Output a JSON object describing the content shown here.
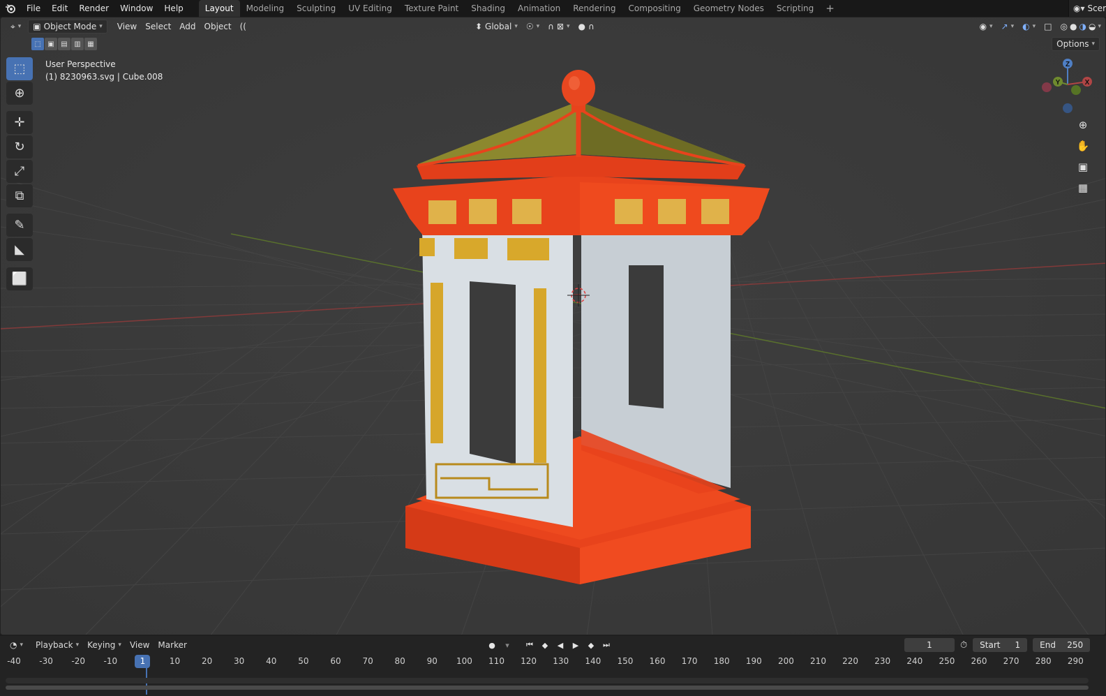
{
  "topbar": {
    "logo_icon": "blender-logo-icon",
    "menus": [
      "File",
      "Edit",
      "Render",
      "Window",
      "Help"
    ],
    "workspaces": [
      "Layout",
      "Modeling",
      "Sculpting",
      "UV Editing",
      "Texture Paint",
      "Shading",
      "Animation",
      "Rendering",
      "Compositing",
      "Geometry Nodes",
      "Scripting"
    ],
    "active_workspace": "Layout",
    "add_workspace": "+",
    "scene_label": "Scer"
  },
  "viewport_header": {
    "editor_type_icon": "3d-viewport-icon",
    "mode": "Object Mode",
    "menus": [
      "View",
      "Select",
      "Add",
      "Object"
    ],
    "transform_orientation": "Global",
    "options_label": "Options"
  },
  "viewport": {
    "perspective_label": "User Perspective",
    "object_label": "(1) 8230963.svg | Cube.008",
    "gizmo_axes": {
      "x": "X",
      "y": "Y",
      "z": "Z"
    },
    "colors": {
      "background": "#3a3a3a",
      "x_axis": "#b04545",
      "y_axis": "#6f8a2e",
      "z_axis": "#4f7fc4",
      "accent": "#4772b3",
      "model_red": "#e8431c",
      "model_gold": "#d8a82b",
      "model_white": "#d7dde2"
    }
  },
  "toolbar": {
    "tools": [
      {
        "name": "select-box",
        "icon": "select-box-icon",
        "active": true
      },
      {
        "name": "cursor",
        "icon": "cursor-icon",
        "active": false
      },
      {
        "name": "move",
        "icon": "move-icon",
        "active": false
      },
      {
        "name": "rotate",
        "icon": "rotate-icon",
        "active": false
      },
      {
        "name": "scale",
        "icon": "scale-icon",
        "active": false
      },
      {
        "name": "transform",
        "icon": "transform-icon",
        "active": false
      },
      {
        "name": "annotate",
        "icon": "annotate-icon",
        "active": false
      },
      {
        "name": "measure",
        "icon": "measure-icon",
        "active": false
      },
      {
        "name": "add-cube",
        "icon": "add-cube-icon",
        "active": false
      }
    ]
  },
  "timeline": {
    "editor_icon": "timeline-editor-icon",
    "menus": [
      "Playback",
      "Keying",
      "View",
      "Marker"
    ],
    "current_frame": "1",
    "start_label": "Start",
    "start_value": "1",
    "end_label": "End",
    "end_value": "250",
    "ruler_ticks": [
      "-40",
      "-30",
      "-20",
      "-10",
      "1",
      "10",
      "20",
      "30",
      "40",
      "50",
      "60",
      "70",
      "80",
      "90",
      "100",
      "110",
      "120",
      "130",
      "140",
      "150",
      "160",
      "170",
      "180",
      "190",
      "200",
      "210",
      "220",
      "230",
      "240",
      "250",
      "260",
      "270",
      "280",
      "290"
    ]
  }
}
